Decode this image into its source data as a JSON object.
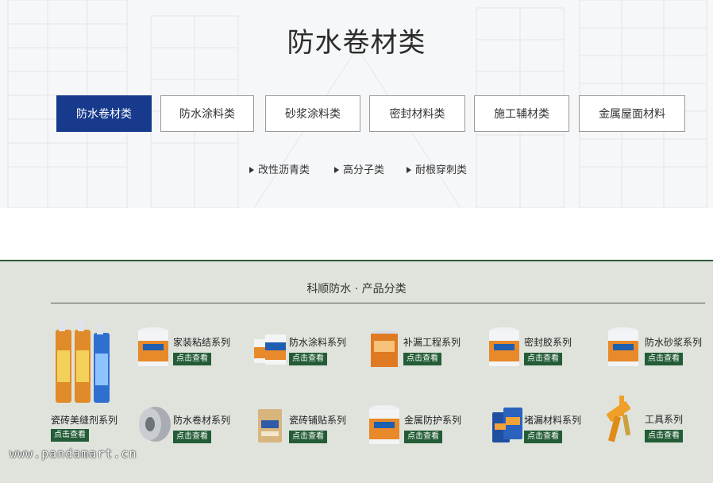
{
  "hero": {
    "title": "防水卷材类",
    "tabs": [
      {
        "label": "防水卷材类",
        "active": true
      },
      {
        "label": "防水涂料类",
        "active": false
      },
      {
        "label": "砂浆涂料类",
        "active": false
      },
      {
        "label": "密封材料类",
        "active": false
      },
      {
        "label": "施工辅材类",
        "active": false
      },
      {
        "label": "金属屋面材料",
        "active": false
      }
    ],
    "subtabs": [
      "改性沥青类",
      "高分子类",
      "耐根穿刺类"
    ]
  },
  "categories": {
    "title": "科顺防水 · 产品分类",
    "button_label": "点击查看",
    "items": [
      {
        "name": "瓷砖美缝剂系列",
        "icon": "caulk-tubes-icon"
      },
      {
        "name": "家装粘结系列",
        "icon": "paint-bucket-icon"
      },
      {
        "name": "防水涂料系列",
        "icon": "paint-buckets-icon"
      },
      {
        "name": "补漏工程系列",
        "icon": "paint-can-icon"
      },
      {
        "name": "密封胶系列",
        "icon": "paint-bucket-icon"
      },
      {
        "name": "防水砂浆系列",
        "icon": "paint-bucket-icon"
      },
      {
        "name": "防水卷材系列",
        "icon": "tape-roll-icon"
      },
      {
        "name": "瓷砖铺贴系列",
        "icon": "cement-bag-icon"
      },
      {
        "name": "金属防护系列",
        "icon": "paint-bucket-icon"
      },
      {
        "name": "堵漏材料系列",
        "icon": "powder-bags-icon"
      },
      {
        "name": "工具系列",
        "icon": "caulking-gun-icon"
      }
    ]
  },
  "colors": {
    "accent": "#173a8c",
    "button": "#235c36",
    "section_bg": "#dfe3dc",
    "bucket_orange": "#e8892a"
  },
  "watermark": "www.pandamart.cn"
}
